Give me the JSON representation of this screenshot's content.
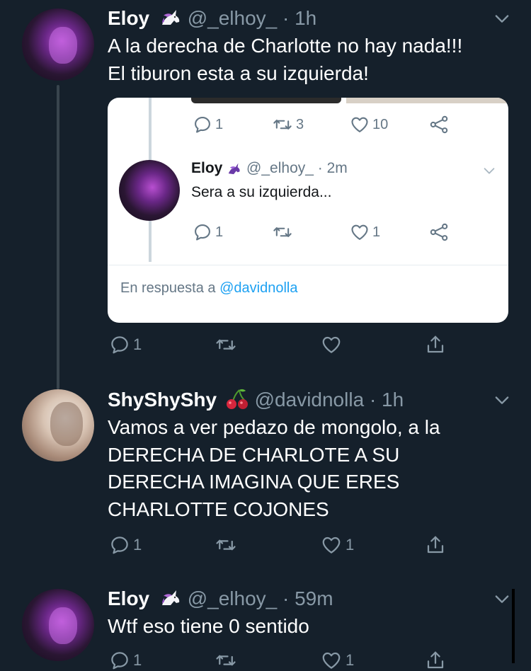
{
  "tweets": [
    {
      "name": "Eloy",
      "handle": "@_elhoy_",
      "time": "· 1h",
      "emoji_icon": "unicorn-icon",
      "text_lines": [
        "A la derecha de Charlotte no hay nada!!!",
        "El tiburon esta a su izquierda!"
      ],
      "embedded": {
        "top_actions": {
          "reply_count": "1",
          "retweet_count": "3",
          "like_count": "10"
        },
        "reply": {
          "name": "Eloy",
          "handle": "@_elhoy_",
          "time": "· 2m",
          "text": "Sera a su izquierda...",
          "reply_count": "1",
          "like_count": "1"
        },
        "reply_to_prefix": "En respuesta a ",
        "reply_to_mention": "@davidnolla"
      },
      "actions": {
        "reply_count": "1",
        "retweet_count": "",
        "like_count": ""
      }
    },
    {
      "name": "ShyShyShy",
      "handle": "@davidnolla",
      "time": "· 1h",
      "emoji_icon": "cherries-icon",
      "text_lines": [
        "Vamos a ver pedazo de mongolo, a la",
        "DERECHA DE CHARLOTE A SU",
        "DERECHA IMAGINA QUE ERES",
        "CHARLOTTE COJONES"
      ],
      "actions": {
        "reply_count": "1",
        "retweet_count": "",
        "like_count": "1"
      }
    },
    {
      "name": "Eloy",
      "handle": "@_elhoy_",
      "time": "· 59m",
      "emoji_icon": "unicorn-icon",
      "text_lines": [
        "Wtf eso tiene 0 sentido"
      ],
      "actions": {
        "reply_count": "1",
        "retweet_count": "",
        "like_count": "1"
      }
    }
  ],
  "colors": {
    "background": "#15202b",
    "secondary_text": "#8899a6",
    "link": "#1da1f2"
  }
}
